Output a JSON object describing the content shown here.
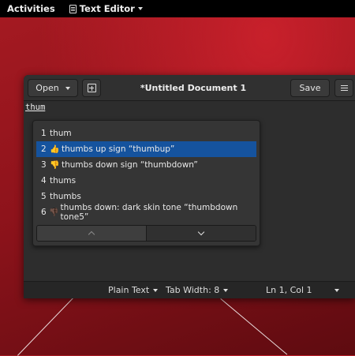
{
  "topbar": {
    "activities": "Activities",
    "app_name": "Text Editor"
  },
  "window": {
    "open_label": "Open",
    "title": "*Untitled Document 1",
    "save_label": "Save",
    "typed_text": "thum"
  },
  "completion": {
    "items": [
      {
        "num": "1",
        "emoji": "",
        "text": "thum"
      },
      {
        "num": "2",
        "emoji": "👍",
        "text": "thumbs up sign “thumbup”"
      },
      {
        "num": "3",
        "emoji": "👎",
        "text": "thumbs down sign “thumbdown”"
      },
      {
        "num": "4",
        "emoji": "",
        "text": "thums"
      },
      {
        "num": "5",
        "emoji": "",
        "text": "thumbs"
      },
      {
        "num": "6",
        "emoji": "👎🏿",
        "text": "thumbs down: dark skin tone “thumbdown tone5”"
      }
    ]
  },
  "statusbar": {
    "language": "Plain Text",
    "tab_width": "Tab Width: 8",
    "position": "Ln 1, Col 1"
  }
}
